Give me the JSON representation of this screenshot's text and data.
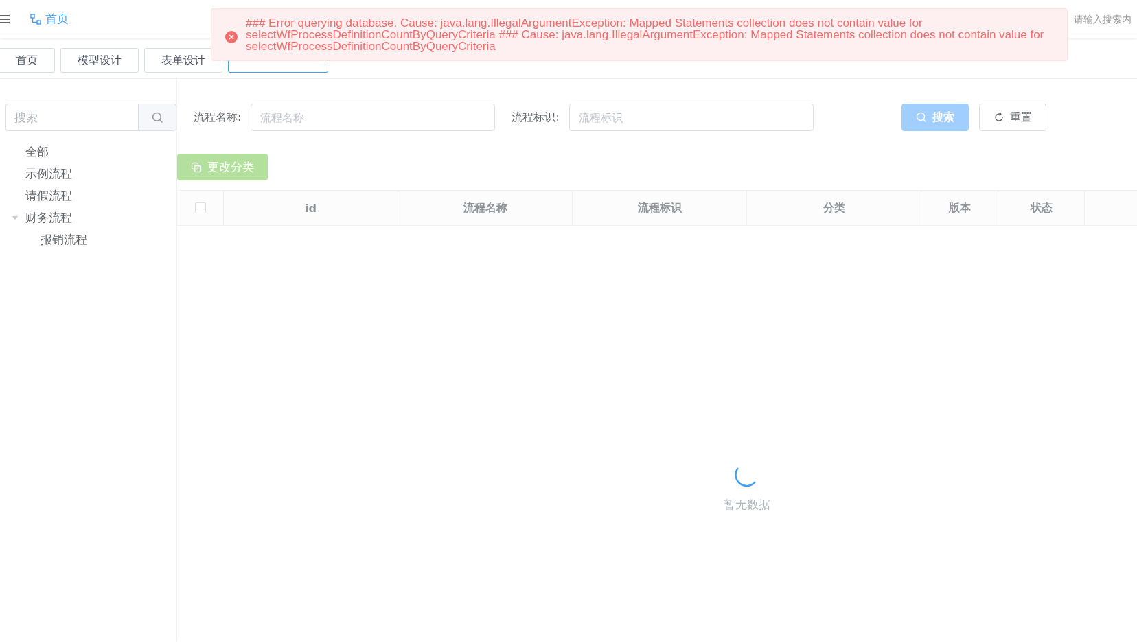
{
  "header": {
    "breadcrumb": "首页",
    "search": {
      "placeholder": "请输入搜索内"
    }
  },
  "alert": {
    "kind": "error",
    "message": "### Error querying database. Cause: java.lang.IllegalArgumentException: Mapped Statements collection does not contain value for selectWfProcessDefinitionCountByQueryCriteria ### Cause: java.lang.IllegalArgumentException: Mapped Statements collection does not contain value for selectWfProcessDefinitionCountByQueryCriteria"
  },
  "tabs": [
    {
      "label": "首页",
      "selected": false
    },
    {
      "label": "模型设计",
      "selected": false
    },
    {
      "label": "表单设计",
      "selected": false
    },
    {
      "selected": true
    }
  ],
  "sidebar": {
    "search": {
      "placeholder": "搜索"
    },
    "tree": [
      {
        "label": "全部"
      },
      {
        "label": "示例流程"
      },
      {
        "label": "请假流程"
      },
      {
        "label": "财务流程",
        "expanded": true,
        "children": [
          {
            "label": "报销流程"
          }
        ]
      }
    ]
  },
  "filters": [
    {
      "label": "流程名称:",
      "placeholder": "流程名称"
    },
    {
      "label": "流程标识:",
      "placeholder": "流程标识"
    }
  ],
  "buttons": [
    {
      "kind": "primary",
      "label": "搜索"
    },
    {
      "kind": "default",
      "label": "重置"
    }
  ],
  "toolbar": {
    "label": "更改分类"
  },
  "table": {
    "columns": [
      "id",
      "流程名称",
      "流程标识",
      "分类",
      "版本",
      "状态"
    ],
    "select_all": {
      "checked": false
    },
    "empty_text": "暂无数据"
  }
}
